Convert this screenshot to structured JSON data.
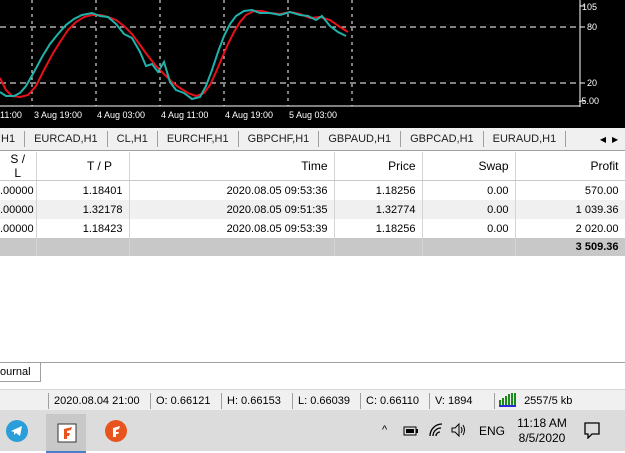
{
  "chart": {
    "y_labels": [
      "105",
      "80",
      "20",
      "-5.00"
    ],
    "x_labels": [
      "11:00",
      "3 Aug 19:00",
      "4 Aug 03:00",
      "4 Aug 11:00",
      "4 Aug 19:00",
      "5 Aug 03:00"
    ]
  },
  "symbol_tabs": [
    "H1",
    "EURCAD,H1",
    "CL,H1",
    "EURCHF,H1",
    "GBPCHF,H1",
    "GBPAUD,H1",
    "GBPCAD,H1",
    "EURAUD,H1"
  ],
  "tab_arrows": {
    "left": "◀",
    "right": "▶"
  },
  "table": {
    "headers": {
      "sl": "S / L",
      "tp": "T / P",
      "time": "Time",
      "price": "Price",
      "swap": "Swap",
      "profit": "Profit"
    },
    "rows": [
      {
        "sl": ".00000",
        "tp": "1.18401",
        "time": "2020.08.05 09:53:36",
        "price": "1.18256",
        "swap": "0.00",
        "profit": "570.00"
      },
      {
        "sl": ".00000",
        "tp": "1.32178",
        "time": "2020.08.05 09:51:35",
        "price": "1.32774",
        "swap": "0.00",
        "profit": "1 039.36"
      },
      {
        "sl": ".00000",
        "tp": "1.18423",
        "time": "2020.08.05 09:53:39",
        "price": "1.18256",
        "swap": "0.00",
        "profit": "2 020.00"
      }
    ],
    "total_profit": "3 509.36"
  },
  "bottom_tab": {
    "journal": "ournal"
  },
  "status_bar": {
    "datetime": "2020.08.04 21:00",
    "open": "O: 0.66121",
    "high": "H: 0.66153",
    "low": "L: 0.66039",
    "close": "C: 0.66110",
    "volume": "V: 1894",
    "traffic": "2557/5 kb"
  },
  "taskbar": {
    "language": "ENG",
    "time": "11:18 AM",
    "date": "8/5/2020",
    "colors": {
      "telegram": "#2a9ed8",
      "app_f": "#e8541e"
    }
  }
}
